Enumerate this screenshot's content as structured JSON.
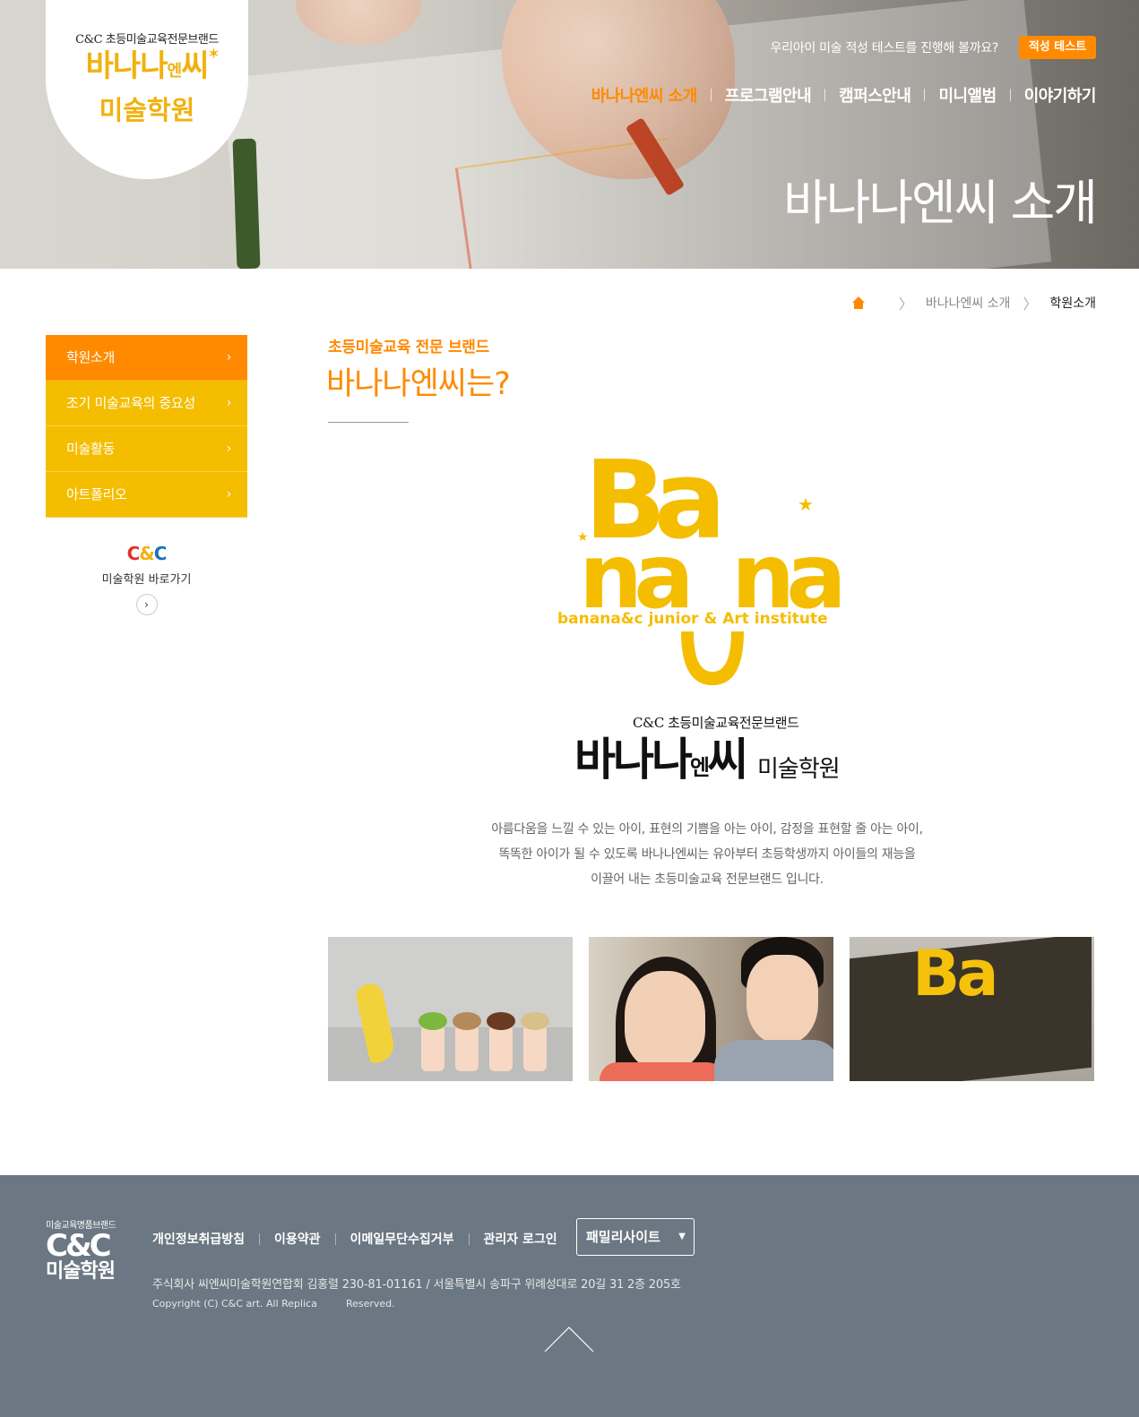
{
  "header": {
    "logo": {
      "tagline": "C&C 초등미술교육전문브랜드",
      "name_part1": "바나나",
      "name_small": "엔",
      "name_part2": "씨",
      "school": "미술학원"
    },
    "test_prompt": "우리아이 미술 적성 테스트를 진행해 볼까요?",
    "test_button": "적성 테스트",
    "nav": [
      {
        "label": "바나나엔씨 소개",
        "active": true
      },
      {
        "label": "프로그램안내",
        "active": false
      },
      {
        "label": "캠퍼스안내",
        "active": false
      },
      {
        "label": "미니앨범",
        "active": false
      },
      {
        "label": "이야기하기",
        "active": false
      }
    ],
    "page_title": "바나나엔씨 소개"
  },
  "breadcrumb": {
    "icon": "home-icon",
    "level1": "바나나엔씨 소개",
    "current": "학원소개"
  },
  "sidebar": {
    "menu": [
      {
        "label": "학원소개",
        "active": true
      },
      {
        "label": "조기 미술교육의 중요성",
        "active": false
      },
      {
        "label": "미술활동",
        "active": false
      },
      {
        "label": "아트폴리오",
        "active": false
      }
    ],
    "cc_link": {
      "logo": "C&C",
      "label": "미술학원 바로가기"
    }
  },
  "content": {
    "subtitle": "초등미술교육 전문 브랜드",
    "title": "바나나엔씨는?",
    "brand_logo_text": "banana&c junior & Art institute",
    "brand_sub": "C&C 초등미술교육전문브랜드",
    "brand_name_part1": "바나나",
    "brand_name_small": "엔",
    "brand_name_part2": "씨",
    "brand_school": "미술학원",
    "description": [
      "아름다움을 느낄 수 있는 아이, 표현의 기쁨을 아는 아이, 감정을 표현할 줄 아는 아이,",
      "똑똑한 아이가 될 수 있도록 바나나엔씨는 유아부터 초등학생까지 아이들의 재능을",
      "이끌어 내는 초등미술교육 전문브랜드 입니다."
    ]
  },
  "footer": {
    "logo": {
      "tagline": "미술교육명품브랜드",
      "cc": "C&C",
      "school": "미술학원"
    },
    "links": [
      "개인정보취급방침",
      "이용약관",
      "이메일무단수집거부",
      "관리자 로그인"
    ],
    "family_site": "패밀리사이트",
    "address": "주식회사 씨엔씨미술학원연합회 김홍렬 230-81-01161 / 서울특별시 송파구 위례성대로 20길 31 2층 205호",
    "copyright_a": "Copyright (C) C&C art. All Replica",
    "copyright_b": "Reserved."
  },
  "colors": {
    "accent": "#ff8a00",
    "yellow": "#f5bd00",
    "footer_bg": "#6b7782"
  }
}
